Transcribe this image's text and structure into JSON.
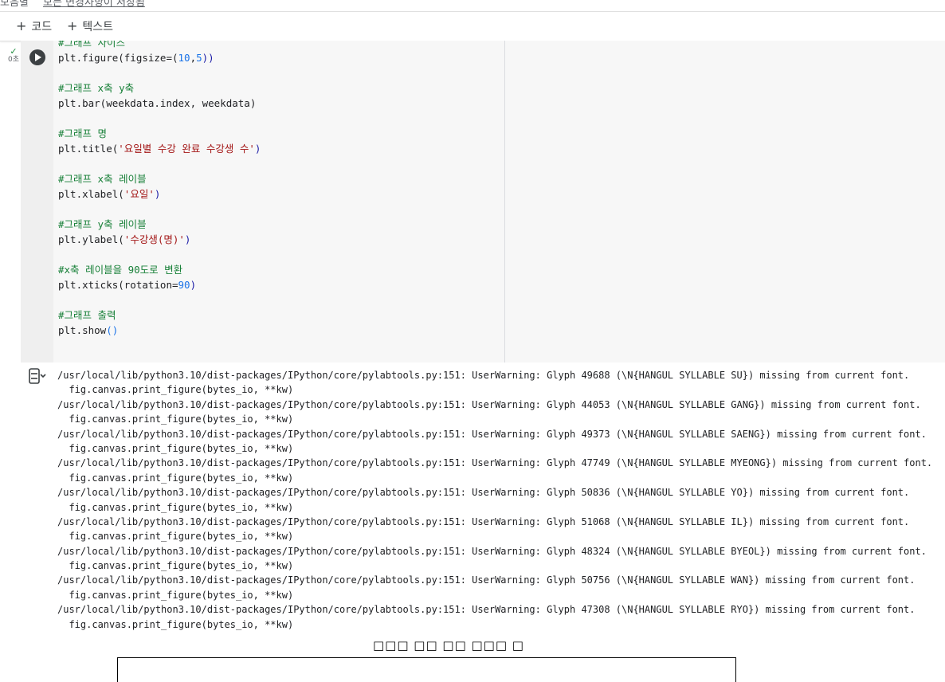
{
  "top": {
    "label": "모음별",
    "link": "모든 변경사항이 저장됨"
  },
  "toolbar": {
    "add_code": "코드",
    "add_text": "텍스트"
  },
  "cell_status": {
    "exec_time": "0초"
  },
  "code": {
    "l1": "#그래프 사이즈",
    "l2a": "plt.figure(figsize=(",
    "l2b": "10",
    "l2c": ",",
    "l2d": "5",
    "l2e": "))",
    "l3": "#그래프 x축 y축",
    "l4": "plt.bar(weekdata.index, weekdata)",
    "l5": "#그래프 명",
    "l6a": "plt.title(",
    "l6b": "'요일별 수강 완료 수강생 수'",
    "l6c": ")",
    "l7": "#그래프 x축 레이블",
    "l8a": "plt.xlabel(",
    "l8b": "'요일'",
    "l8c": ")",
    "l9": "#그래프 y축 레이블",
    "l10a": "plt.ylabel(",
    "l10b": "'수강생(명)'",
    "l10c": ")",
    "l11": "#x축 레이블을 90도로 변환",
    "l12a": "plt.xticks(rotation=",
    "l12b": "90",
    "l12c": ")",
    "l13": "#그래프 출력",
    "l14a": "plt.show",
    "l14b": "()"
  },
  "output": {
    "lines": [
      "/usr/local/lib/python3.10/dist-packages/IPython/core/pylabtools.py:151: UserWarning: Glyph 49688 (\\N{HANGUL SYLLABLE SU}) missing from current font.",
      "  fig.canvas.print_figure(bytes_io, **kw)",
      "/usr/local/lib/python3.10/dist-packages/IPython/core/pylabtools.py:151: UserWarning: Glyph 44053 (\\N{HANGUL SYLLABLE GANG}) missing from current font.",
      "  fig.canvas.print_figure(bytes_io, **kw)",
      "/usr/local/lib/python3.10/dist-packages/IPython/core/pylabtools.py:151: UserWarning: Glyph 49373 (\\N{HANGUL SYLLABLE SAENG}) missing from current font.",
      "  fig.canvas.print_figure(bytes_io, **kw)",
      "/usr/local/lib/python3.10/dist-packages/IPython/core/pylabtools.py:151: UserWarning: Glyph 47749 (\\N{HANGUL SYLLABLE MYEONG}) missing from current font.",
      "  fig.canvas.print_figure(bytes_io, **kw)",
      "/usr/local/lib/python3.10/dist-packages/IPython/core/pylabtools.py:151: UserWarning: Glyph 50836 (\\N{HANGUL SYLLABLE YO}) missing from current font.",
      "  fig.canvas.print_figure(bytes_io, **kw)",
      "/usr/local/lib/python3.10/dist-packages/IPython/core/pylabtools.py:151: UserWarning: Glyph 51068 (\\N{HANGUL SYLLABLE IL}) missing from current font.",
      "  fig.canvas.print_figure(bytes_io, **kw)",
      "/usr/local/lib/python3.10/dist-packages/IPython/core/pylabtools.py:151: UserWarning: Glyph 48324 (\\N{HANGUL SYLLABLE BYEOL}) missing from current font.",
      "  fig.canvas.print_figure(bytes_io, **kw)",
      "/usr/local/lib/python3.10/dist-packages/IPython/core/pylabtools.py:151: UserWarning: Glyph 50756 (\\N{HANGUL SYLLABLE WAN}) missing from current font.",
      "  fig.canvas.print_figure(bytes_io, **kw)",
      "/usr/local/lib/python3.10/dist-packages/IPython/core/pylabtools.py:151: UserWarning: Glyph 47308 (\\N{HANGUL SYLLABLE RYO}) missing from current font.",
      "  fig.canvas.print_figure(bytes_io, **kw)"
    ],
    "chart_title": "□□□ □□ □□ □□□ □"
  },
  "icons": {
    "add_code": "plus-icon",
    "add_text": "plus-icon",
    "status": "check-icon",
    "run": "play-icon",
    "output_toggle": "output-collapse-icon"
  },
  "colors": {
    "comment": "#188038",
    "string": "#a31515",
    "number": "#1a73e8",
    "check": "#1e8e3e"
  }
}
